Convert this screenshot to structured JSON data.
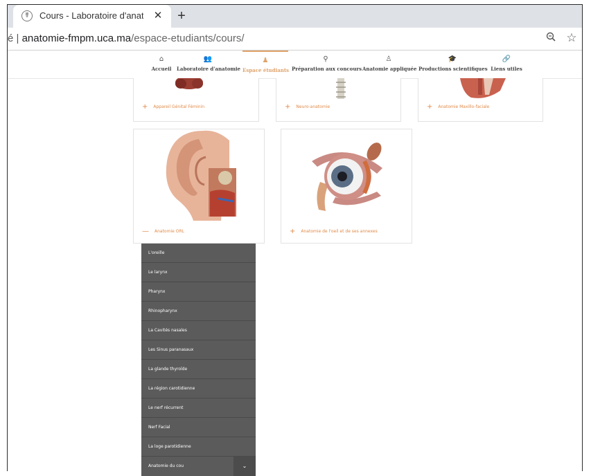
{
  "browser": {
    "tab_title": "Cours - Laboratoire d'anatomie",
    "tab_close": "✕",
    "new_tab": "+",
    "address_prefix": "é | ",
    "address_domain": "anatomie-fmpm.uca.ma",
    "address_path": "/espace-etudiants/cours/",
    "zoom_icon": "zoom-out-icon",
    "bookmark_icon": "star-icon"
  },
  "nav": {
    "items": [
      {
        "label": "Accueil",
        "icon": "home-icon",
        "glyph": "⌂"
      },
      {
        "label": "Laboratoire d'anatomie",
        "icon": "users-icon",
        "glyph": "👥"
      },
      {
        "label": "Espace étudiants",
        "icon": "student-icon",
        "glyph": "♟",
        "active": true
      },
      {
        "label": "Préparation aux concours",
        "icon": "graduate-icon",
        "glyph": "⚲"
      },
      {
        "label": "Anatomie appliquée",
        "icon": "doctor-icon",
        "glyph": "♙"
      },
      {
        "label": "Productions scientifiques",
        "icon": "mortarboard-icon",
        "glyph": "🎓"
      },
      {
        "label": "Liens utiles",
        "icon": "link-icon",
        "glyph": "🔗"
      }
    ]
  },
  "courses": {
    "row1": [
      {
        "label": "Appareil Génital Féminin"
      },
      {
        "label": "Neuro-anatomie"
      },
      {
        "label": "Anatomie Maxillo-faciale"
      }
    ],
    "ent": {
      "label": "Anatomie ORL",
      "toggle": "—"
    },
    "eye": {
      "label": "Anatomie de l'oeil et de ses annexes",
      "toggle": "+"
    }
  },
  "orl_menu": [
    "L'oreille",
    "Le larynx",
    "Pharynx",
    "Rhinopharynx",
    "La Cavités nasales",
    "Les Sinus paranasaux",
    "La glande thyroïde",
    "La région carotidienne",
    "Le nerf récurrent",
    "Nerf Facial",
    "La loge parotidienne",
    "Anatomie du cou"
  ]
}
